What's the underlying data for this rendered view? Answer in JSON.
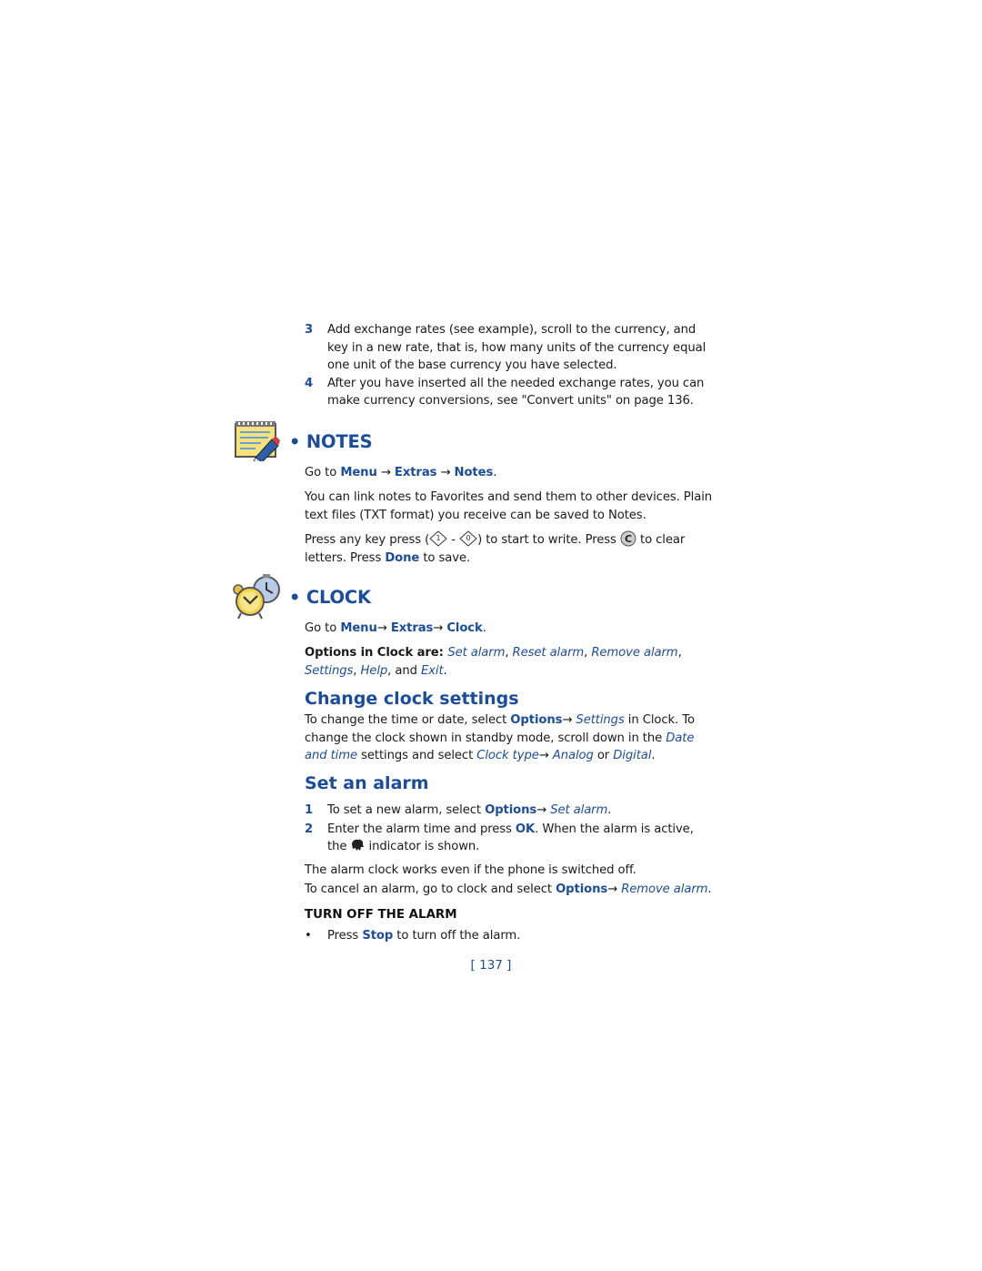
{
  "exchange_steps": [
    {
      "num": "3",
      "text": "Add exchange rates (see example), scroll to the currency, and key in a new rate, that is, how many units of the currency equal one unit of the base currency you have selected."
    },
    {
      "num": "4",
      "text": "After you have inserted all the needed exchange rates, you can make currency conversions, see \"Convert units\" on page 136."
    }
  ],
  "notes": {
    "heading": "• NOTES",
    "icon": "notepad-pencil-icon",
    "goto": {
      "prefix": "Go to ",
      "menu": "Menu",
      "arrow": " → ",
      "extras": "Extras",
      "item": "Notes",
      "suffix": "."
    },
    "para1": "You can link notes to Favorites and send them to other devices. Plain text files (TXT format) you receive can be saved to Notes.",
    "para2": {
      "t1": "Press any key press (",
      "key1_icon": "key-1-icon",
      "dash": " - ",
      "key2_icon": "key-0-icon",
      "t2": ") to start to write. Press ",
      "clear_icon": "clear-key-icon",
      "t3": " to clear letters. Press ",
      "done": "Done",
      "t4": " to save."
    }
  },
  "clock": {
    "heading": "• CLOCK",
    "icon": "alarm-clock-icon",
    "goto": {
      "prefix": "Go to ",
      "menu": "Menu",
      "arrow": "→ ",
      "extras": "Extras",
      "item": "Clock",
      "suffix": "."
    },
    "options": {
      "lead": "Options in Clock are: ",
      "items": [
        "Set alarm",
        "Reset alarm",
        "Remove alarm",
        "Settings",
        "Help"
      ],
      "and": "and ",
      "last": "Exit",
      "end": "."
    }
  },
  "change_clock": {
    "heading": "Change clock settings",
    "t1": "To change the time or date, select ",
    "options": "Options",
    "arrow": "→ ",
    "settings": "Settings",
    "t2": " in Clock. To change the clock shown in standby mode, scroll down in the ",
    "date_time": "Date and time",
    "t3": " settings and select ",
    "clock_type": "Clock type",
    "analog": "Analog",
    "or": " or ",
    "digital": "Digital",
    "end": "."
  },
  "set_alarm": {
    "heading": "Set an alarm",
    "steps": [
      {
        "num": "1",
        "t1": "To set a new alarm, select ",
        "options": "Options",
        "arrow": "→ ",
        "action": "Set alarm",
        "end": "."
      },
      {
        "num": "2",
        "t1": "Enter the alarm time and press ",
        "ok": "OK",
        "t2": ". When the alarm is active, the ",
        "indicator_icon": "alarm-indicator-icon",
        "t3": " indicator is shown."
      }
    ],
    "para1": "The alarm clock works even if the phone is switched off.",
    "para2": {
      "t1": "To cancel an alarm, go to clock and select ",
      "options": "Options",
      "arrow": "→ ",
      "action": "Remove alarm",
      "end": "."
    }
  },
  "turn_off": {
    "heading": "TURN OFF THE ALARM",
    "bullet": "•",
    "t1": "Press ",
    "stop": "Stop",
    "t2": " to turn off the alarm."
  },
  "page_number": "[ 137 ]",
  "colors": {
    "accent": "#1b4d9c",
    "text": "#1a1a1a"
  }
}
